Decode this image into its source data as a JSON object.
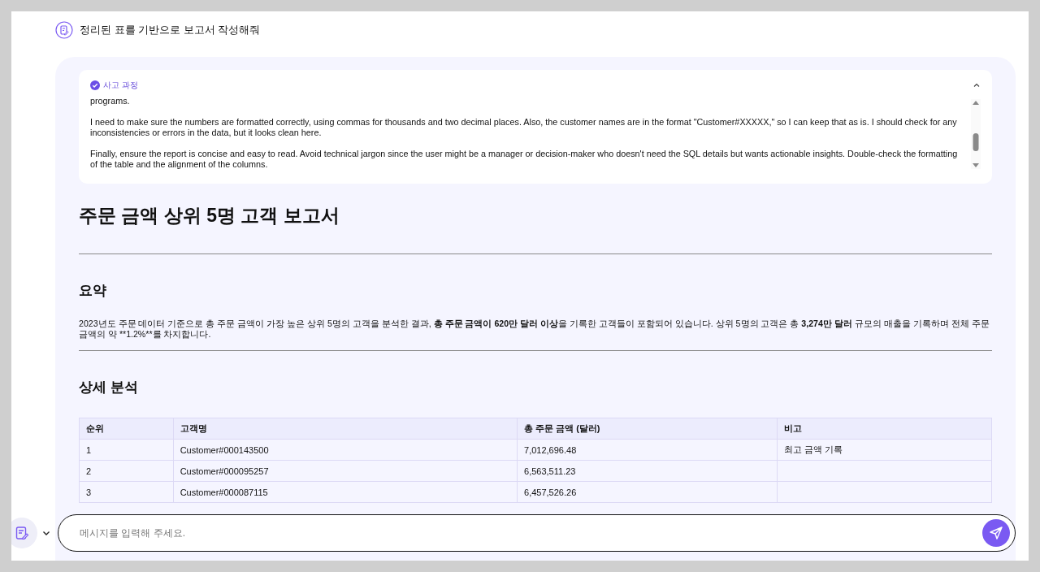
{
  "prompt": {
    "text": "정리된 표를 기반으로 보고서 작성해줘"
  },
  "thinking": {
    "title": "사고 과정",
    "expanded": true,
    "paragraphs": [
      "programs.",
      "I need to make sure the numbers are formatted correctly, using commas for thousands and two decimal places. Also, the customer names are in the format \"Customer#XXXXX,\" so I can keep that as is. I should check for any inconsistencies or errors in the data, but it looks clean here.",
      "Finally, ensure the report is concise and easy to read. Avoid technical jargon since the user might be a manager or decision-maker who doesn't need the SQL details but wants actionable insights. Double-check the formatting of the table and the alignment of the columns."
    ]
  },
  "report": {
    "title": "주문 금액 상위 5명 고객 보고서",
    "summary_heading": "요약",
    "summary_segments": [
      {
        "text": "2023년도 주문 데이터 기준으로 총 주문 금액이 가장 높은 상위 5명의 고객을 분석한 결과, ",
        "bold": false
      },
      {
        "text": "총 주문 금액이 620만 달러 이상",
        "bold": true
      },
      {
        "text": "을 기록한 고객들이 포함되어 있습니다. 상위 5명의 고객은 총 ",
        "bold": false
      },
      {
        "text": "3,274만 달러",
        "bold": true
      },
      {
        "text": " 규모의 매출을 기록하며 전체 주문 금액의 약 **1.2%**를 차지합니다.",
        "bold": false
      }
    ],
    "detail_heading": "상세 분석",
    "table": {
      "columns": [
        "순위",
        "고객명",
        "총 주문 금액 (달러)",
        "비고"
      ],
      "rows": [
        [
          "1",
          "Customer#000143500",
          "7,012,696.48",
          "최고 금액 기록"
        ],
        [
          "2",
          "Customer#000095257",
          "6,563,511.23",
          ""
        ],
        [
          "3",
          "Customer#000087115",
          "6,457,526.26",
          ""
        ]
      ]
    }
  },
  "composer": {
    "placeholder": "메시지를 입력해 주세요."
  }
}
